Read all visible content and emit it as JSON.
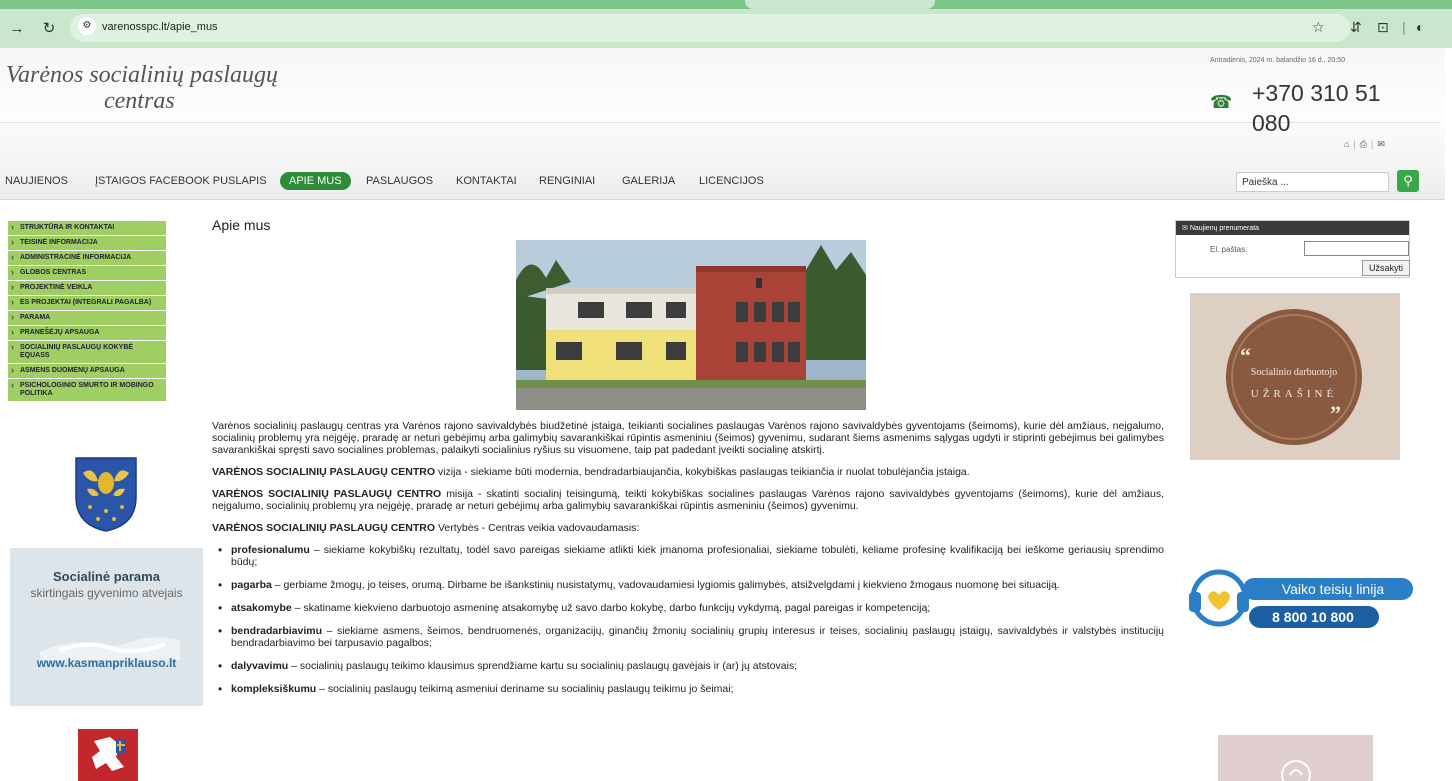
{
  "browser": {
    "url": "varenosspc.lt/apie_mus",
    "icons": [
      "back-arrow-icon",
      "reload-icon",
      "site-info-icon",
      "star-icon",
      "extension-icon",
      "profile-icon"
    ]
  },
  "header": {
    "title_line1": "Varėnos socialinių paslaugų",
    "title_line2": "centras",
    "date": "Antradienis, 2024 m. balandžio 16 d., 20:50",
    "phone": "+370 310 51 080"
  },
  "menu": {
    "items": [
      {
        "label": "NAUJIENOS"
      },
      {
        "label": "ĮSTAIGOS FACEBOOK PUSLAPIS"
      },
      {
        "label": "APIE MUS",
        "active": true
      },
      {
        "label": "PASLAUGOS"
      },
      {
        "label": "KONTAKTAI"
      },
      {
        "label": "RENGINIAI"
      },
      {
        "label": "GALERIJA"
      },
      {
        "label": "LICENCIJOS"
      }
    ],
    "search_placeholder": "Paieška ..."
  },
  "sidebar": {
    "items": [
      {
        "label": "STRUKTŪRA IR KONTAKTAI"
      },
      {
        "label": "TEISINĖ INFORMACIJA"
      },
      {
        "label": "ADMINISTRACINĖ INFORMACIJA"
      },
      {
        "label": "GLOBOS CENTRAS"
      },
      {
        "label": "PROJEKTINĖ VEIKLA"
      },
      {
        "label": "ES PROJEKTAI (INTEGRALI PAGALBA)"
      },
      {
        "label": "PARAMA"
      },
      {
        "label": "PRANEŠĖJŲ APSAUGA"
      },
      {
        "label": "SOCIALINIŲ PASLAUGŲ KOKYBĖ EQUASS"
      },
      {
        "label": "ASMENS DUOMENŲ APSAUGA"
      },
      {
        "label": "PSICHOLOGINIO SMURTO IR MOBINGO POLITIKA"
      }
    ],
    "promo": {
      "title": "Socialinė parama",
      "subtitle": "skirtingais gyvenimo atvejais",
      "url": "www.kasmanpriklauso.lt"
    }
  },
  "main": {
    "title": "Apie mus",
    "intro": "Varėnos socialinių paslaugų centras yra Varėnos rajono savivaldybės biudžetinė įstaiga, teikianti socialines paslaugas Varėnos rajono savivaldybės gyventojams (šeimoms), kurie dėl amžiaus, neįgalumo, socialinių problemų yra neįgėję, praradę ar neturi gebėjimų arba galimybių savarankiškai rūpintis asmeniniu (šeimos) gyvenimu, sudarant šiems asmenims sąlygas ugdyti ir stiprinti gebėjimus bei galimybes savarankiškai spręsti savo socialines problemas, palaikyti socialinius ryšius su visuomene, taip pat padedant įveikti socialinę atskirtį.",
    "org_name": "VARĖNOS SOCIALINIŲ PASLAUGŲ CENTRO",
    "vision": "vizija -  siekiame būti modernia, bendradarbiaujančia, kokybiškas paslaugas teikiančia ir nuolat tobulėjančia įstaiga.",
    "mission": "misija - skatinti socialinį teisingumą, teikti kokybiškas socialines paslaugas Varėnos rajono savivaldybės gyventojams (šeimoms), kurie dėl amžiaus, neįgalumo, socialinių problemų yra neįgėję, praradę ar neturi gebėjimų arba galimybių savarankiškai rūpintis asmeniniu (šeimos) gyvenimu.",
    "values_intro": "Vertybės - Centras veikia vadovaudamasis:",
    "values": [
      {
        "term": "profesionalumu",
        "text": " – siekiame kokybiškų rezultatų, todėl savo pareigas siekiame atlikti kiek įmanoma profesionaliai, siekiame tobulėti, keliame profesinę kvalifikaciją bei ieškome geriausių sprendimo būdų;"
      },
      {
        "term": "pagarba",
        "text": " – gerbiame žmogų, jo teises, orumą. Dirbame be išankstinių  nusistatymų, vadovaudamiesi lygiomis galimybės, atsižvelgdami į kiekvieno žmogaus nuomonę bei situaciją."
      },
      {
        "term": "atsakomybe",
        "text": " – skatiname kiekvieno darbuotojo asmeninę atsakomybę už savo darbo kokybę, darbo funkcijų vykdymą, pagal pareigas ir kompetenciją;"
      },
      {
        "term": "bendradarbiavimu",
        "text": " – siekiame asmens, šeimos, bendruomenės, organizacijų, ginančių žmonių socialinių grupių interesus ir teises, socialinių paslaugų įstaigų, savivaldybės ir valstybės institucijų bendradarbiavimo bei tarpusavio pagalbos;"
      },
      {
        "term": "dalyvavimu",
        "text": " – socialinių paslaugų teikimo klausimus sprendžiame kartu su socialinių paslaugų gavėjais ir (ar) jų atstovais;"
      },
      {
        "term": "kompleksiškumu",
        "text": " – socialinių paslaugų teikimą asmeniui deriname su socialinių paslaugų teikimu jo šeimai;"
      }
    ]
  },
  "right": {
    "subscribe_title": "Naujienų prenumerata",
    "email_label": "El. paštas:",
    "subscribe_button": "Užsakyti",
    "notebook_line1": "Socialinio darbuotojo",
    "notebook_line2": "UŽRAŠINĖ",
    "childline_title": "Vaiko teisių linija",
    "childline_phone": "8 800 10 800"
  }
}
